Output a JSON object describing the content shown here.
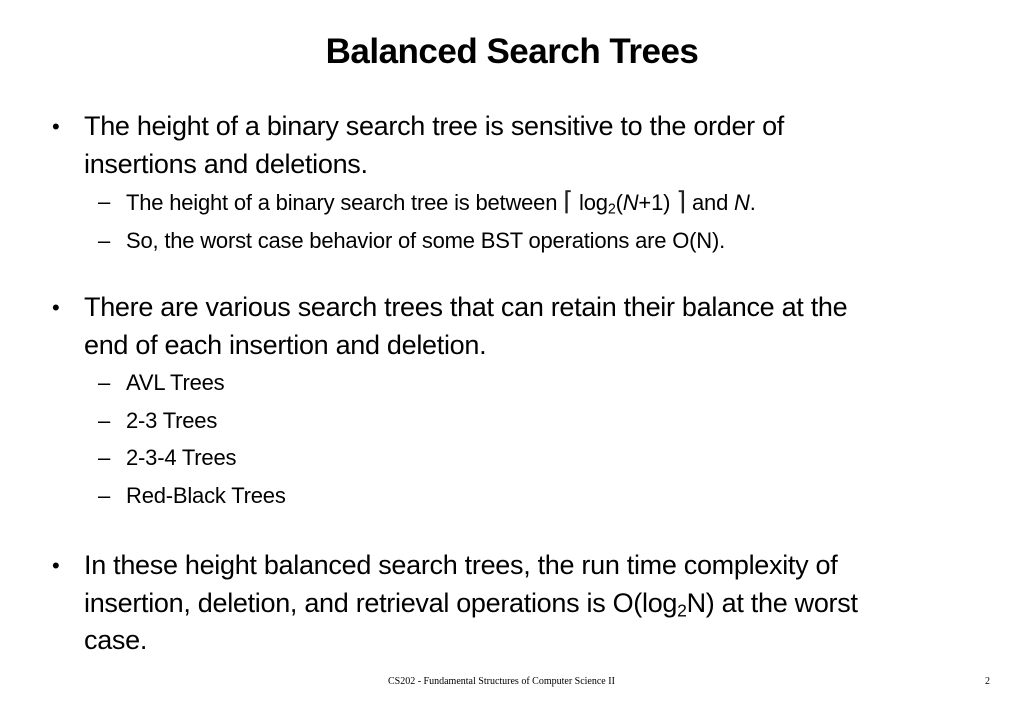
{
  "slide": {
    "title": "Balanced Search Trees",
    "bullets": [
      {
        "lines": [
          "The height of a binary search tree is sensitive to the order of",
          "insertions and deletions."
        ],
        "subitems": [
          {
            "pre": "The height of a binary search tree is between ",
            "ceil_left": "⌈",
            "log": "log",
            "log_sub": "2",
            "paren_open": "(",
            "var_n": "N",
            "plus_one": "+1)",
            "ceil_right": "⌉",
            "and": " and ",
            "var_n2": "N",
            "period": "."
          },
          {
            "text": "So, the worst case behavior of some BST operations are O(N)."
          }
        ]
      },
      {
        "lines": [
          "There are various search trees that can retain their balance at the",
          "end of each insertion and deletion."
        ],
        "subitems": [
          {
            "text": "AVL Trees"
          },
          {
            "text": "2-3 Trees"
          },
          {
            "text": "2-3-4 Trees"
          },
          {
            "text": "Red-Black Trees"
          }
        ]
      },
      {
        "line1": "In these height balanced search trees, the run time complexity of",
        "line2_pre": "insertion, deletion, and retrieval operations is O(log",
        "line2_sub": "2",
        "line2_post": "N) at the worst",
        "line3": "case."
      }
    ],
    "bullet_glyph": "•",
    "dash_glyph": "–",
    "footer": "CS202 - Fundamental Structures of Computer Science II",
    "page_number": "2"
  }
}
